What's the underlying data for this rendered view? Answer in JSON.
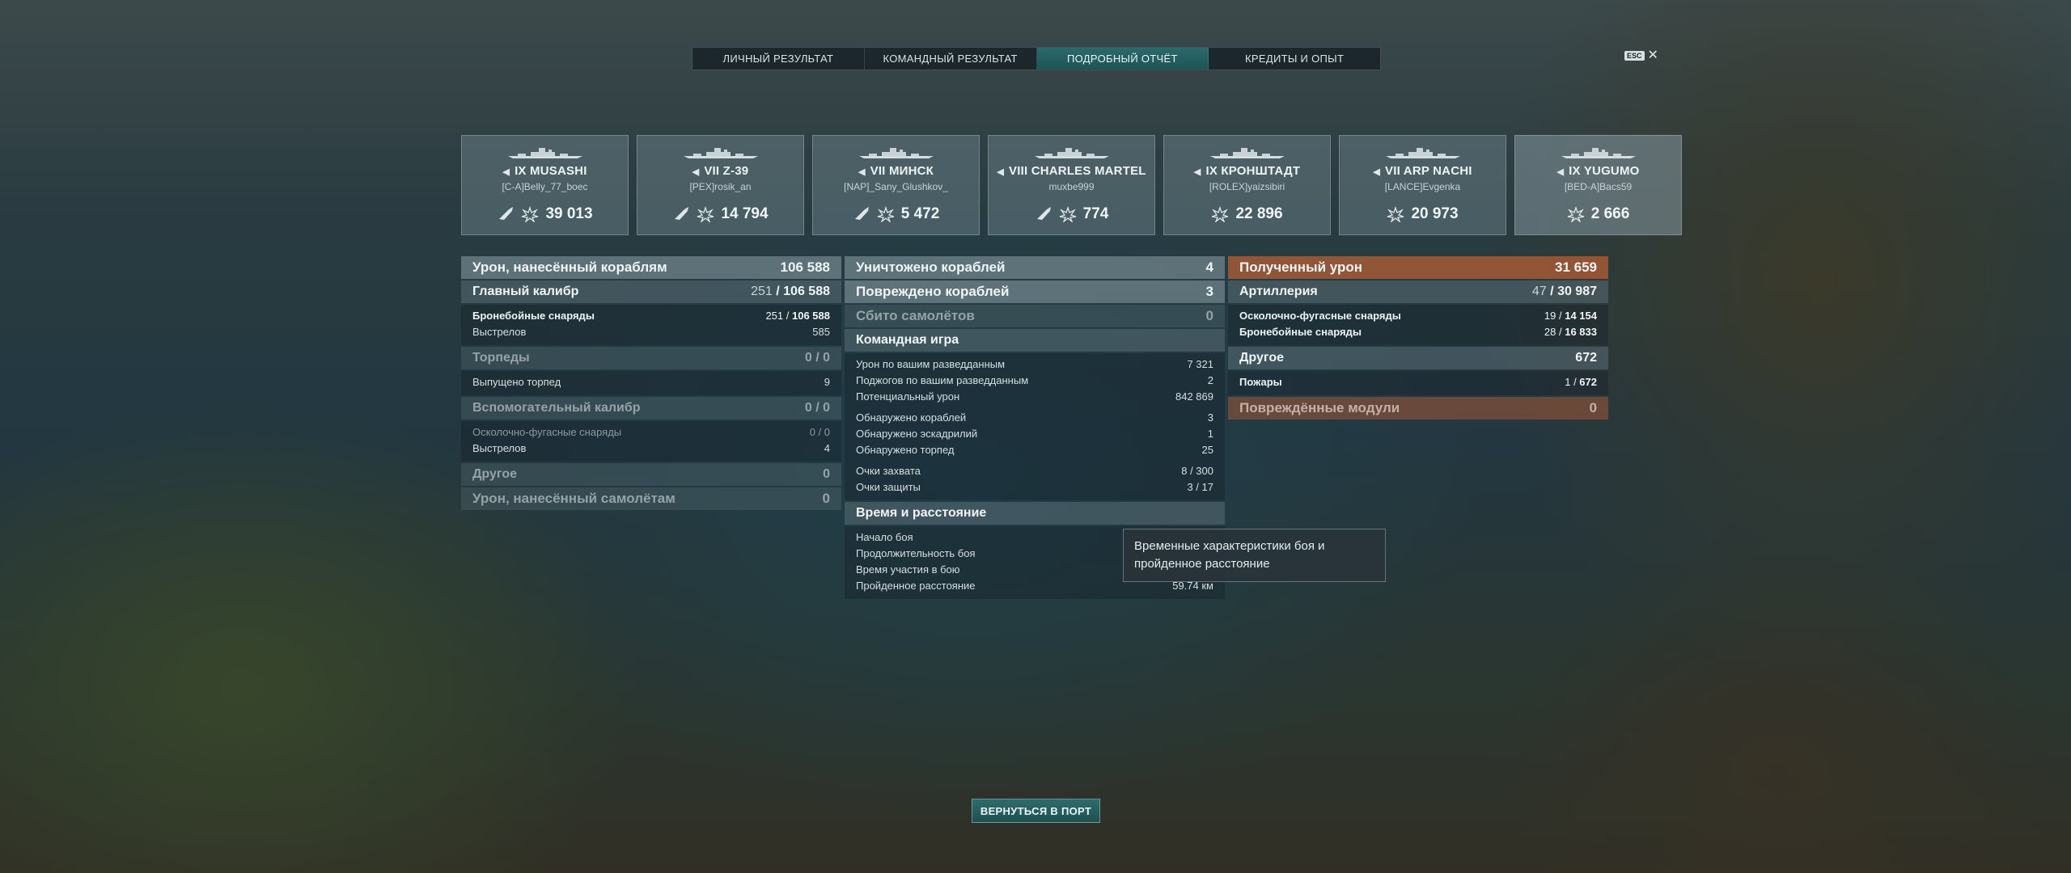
{
  "tabs": [
    "ЛИЧНЫЙ РЕЗУЛЬТАТ",
    "КОМАНДНЫЙ РЕЗУЛЬТАТ",
    "ПОДРОБНЫЙ ОТЧЁТ",
    "КРЕДИТЫ И ОПЫТ"
  ],
  "active_tab": "ПОДРОБНЫЙ ОТЧЁТ",
  "esc_label": "ESC",
  "ships": [
    {
      "tier": "IX",
      "name": "MUSASHI",
      "player": "[C-A]Belly_77_boec",
      "damage": "39 013"
    },
    {
      "tier": "VII",
      "name": "Z-39",
      "player": "[PEX]rosik_an",
      "damage": "14 794"
    },
    {
      "tier": "VII",
      "name": "МИНСК",
      "player": "[NAP]_Sany_Glushkov_",
      "damage": "5 472"
    },
    {
      "tier": "VIII",
      "name": "CHARLES MARTEL",
      "player": "muxbe999",
      "damage": "774"
    },
    {
      "tier": "IX",
      "name": "КРОНШТАДТ",
      "player": "[ROLEX]yaizsibiri",
      "damage": "22 896"
    },
    {
      "tier": "VII",
      "name": "ARP NACHI",
      "player": "[LANCE]Evgenka",
      "damage": "20 973"
    },
    {
      "tier": "IX",
      "name": "YUGUMO",
      "player": "[BED-A]Bacs59",
      "damage": "2 666"
    }
  ],
  "left": {
    "ship_damage": {
      "label": "Урон, нанесённый кораблям",
      "value": "106 588"
    },
    "main_battery": {
      "label": "Главный калибр",
      "hits": "251",
      "value": "106 588"
    },
    "ap_shells": {
      "label": "Бронебойные снаряды",
      "hits": "251",
      "value": "106 588"
    },
    "main_shots": {
      "label": "Выстрелов",
      "value": "585"
    },
    "torpedoes": {
      "label": "Торпеды",
      "value": "0 / 0"
    },
    "torpedoes_launched": {
      "label": "Выпущено торпед",
      "value": "9"
    },
    "secondary": {
      "label": "Вспомогательный калибр",
      "value": "0 / 0"
    },
    "he_shells": {
      "label": "Осколочно-фугасные снаряды",
      "value": "0 / 0"
    },
    "secondary_shots": {
      "label": "Выстрелов",
      "value": "4"
    },
    "other": {
      "label": "Другое",
      "value": "0"
    },
    "plane_damage": {
      "label": "Урон, нанесённый самолётам",
      "value": "0"
    }
  },
  "middle": {
    "destroyed": {
      "label": "Уничтожено кораблей",
      "value": "4"
    },
    "damaged": {
      "label": "Повреждено кораблей",
      "value": "3"
    },
    "planes": {
      "label": "Сбито самолётов",
      "value": "0"
    },
    "team": {
      "title": "Командная игра",
      "spotting_damage": {
        "label": "Урон по вашим разведданным",
        "value": "7 321"
      },
      "spotting_fires": {
        "label": "Поджогов по вашим разведданным",
        "value": "2"
      },
      "potential": {
        "label": "Потенциальный урон",
        "value": "842 869"
      },
      "spotted_ships": {
        "label": "Обнаружено кораблей",
        "value": "3"
      },
      "spotted_squadrons": {
        "label": "Обнаружено эскадрилий",
        "value": "1"
      },
      "spotted_torpedoes": {
        "label": "Обнаружено торпед",
        "value": "25"
      },
      "capture": {
        "label": "Очки захвата",
        "value": "8 / 300"
      },
      "defense": {
        "label": "Очки защиты",
        "value": "3 / 17"
      }
    },
    "time": {
      "title": "Время и расстояние",
      "start": {
        "label": "Начало боя"
      },
      "duration": {
        "label": "Продолжительность боя"
      },
      "participation": {
        "label": "Время участия в бою"
      },
      "distance": {
        "label": "Пройденное расстояние",
        "value": "59.74 км"
      }
    }
  },
  "right": {
    "received": {
      "label": "Полученный урон",
      "value": "31 659"
    },
    "artillery": {
      "label": "Артиллерия",
      "hits": "47",
      "value": "30 987"
    },
    "he": {
      "label": "Осколочно-фугасные снаряды",
      "hits": "19",
      "value": "14 154"
    },
    "ap": {
      "label": "Бронебойные снаряды",
      "hits": "28",
      "value": "16 833"
    },
    "other": {
      "label": "Другое",
      "value": "672"
    },
    "fires": {
      "label": "Пожары",
      "hits": "1",
      "value": "672"
    },
    "modules": {
      "label": "Повреждённые модули",
      "value": "0"
    }
  },
  "tooltip": "Временные характеристики боя и пройденное расстояние",
  "back_button": "ВЕРНУТЬСЯ В ПОРТ",
  "colors": {
    "accent": "#2b6a6a",
    "received_header": "#b05c34"
  }
}
